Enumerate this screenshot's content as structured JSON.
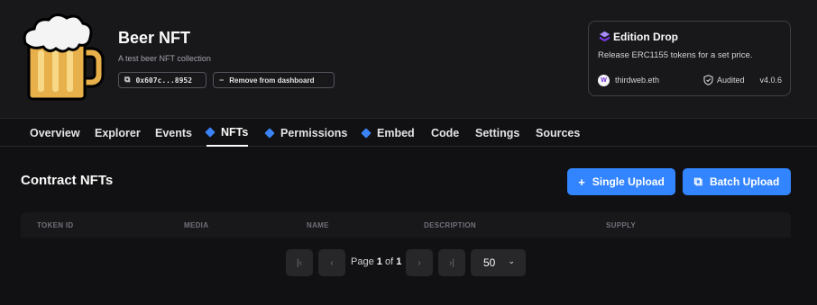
{
  "contract": {
    "name": "Beer NFT",
    "description": "A test beer NFT collection",
    "address": "0x607c...8952",
    "remove_label": "Remove from dashboard",
    "logo": "beer-mug-icon"
  },
  "card": {
    "title": "Edition Drop",
    "description": "Release ERC1155 tokens for a set price.",
    "publisher": "thirdweb.eth",
    "publisher_initial": "W",
    "audited_label": "Audited",
    "version": "v4.0.6",
    "accent": "#8b5cf6"
  },
  "tabs": [
    {
      "label": "Overview",
      "icon": false,
      "active": false
    },
    {
      "label": "Explorer",
      "icon": false,
      "active": false
    },
    {
      "label": "Events",
      "icon": false,
      "active": false
    },
    {
      "label": "NFTs",
      "icon": true,
      "active": true
    },
    {
      "label": "Permissions",
      "icon": true,
      "active": false
    },
    {
      "label": "Embed",
      "icon": true,
      "active": false
    },
    {
      "label": "Code",
      "icon": false,
      "active": false
    },
    {
      "label": "Settings",
      "icon": false,
      "active": false
    },
    {
      "label": "Sources",
      "icon": false,
      "active": false
    }
  ],
  "main": {
    "title": "Contract NFTs",
    "single_upload_label": "Single Upload",
    "batch_upload_label": "Batch Upload",
    "button_color": "#3385ff"
  },
  "table": {
    "columns": [
      "TOKEN ID",
      "MEDIA",
      "NAME",
      "DESCRIPTION",
      "SUPPLY"
    ]
  },
  "pagination": {
    "page_prefix": "Page",
    "current_page": "1",
    "of_label": "of",
    "total_pages": "1",
    "page_size": "50"
  }
}
